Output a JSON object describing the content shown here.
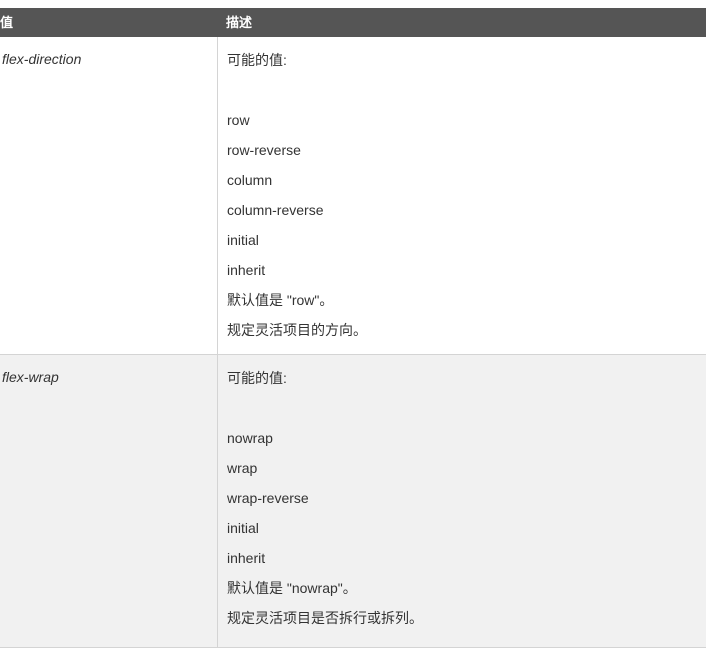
{
  "header": {
    "col1": "值",
    "col2": "描述"
  },
  "rows": [
    {
      "name": "flex-direction",
      "intro": "可能的值:",
      "values": [
        "row",
        "row-reverse",
        "column",
        "column-reverse",
        "initial",
        "inherit"
      ],
      "default": "默认值是 \"row\"。",
      "desc": "规定灵活项目的方向。"
    },
    {
      "name": "flex-wrap",
      "intro": "可能的值:",
      "values": [
        "nowrap",
        "wrap",
        "wrap-reverse",
        "initial",
        "inherit"
      ],
      "default": "默认值是 \"nowrap\"。",
      "desc": "规定灵活项目是否拆行或拆列。"
    }
  ]
}
